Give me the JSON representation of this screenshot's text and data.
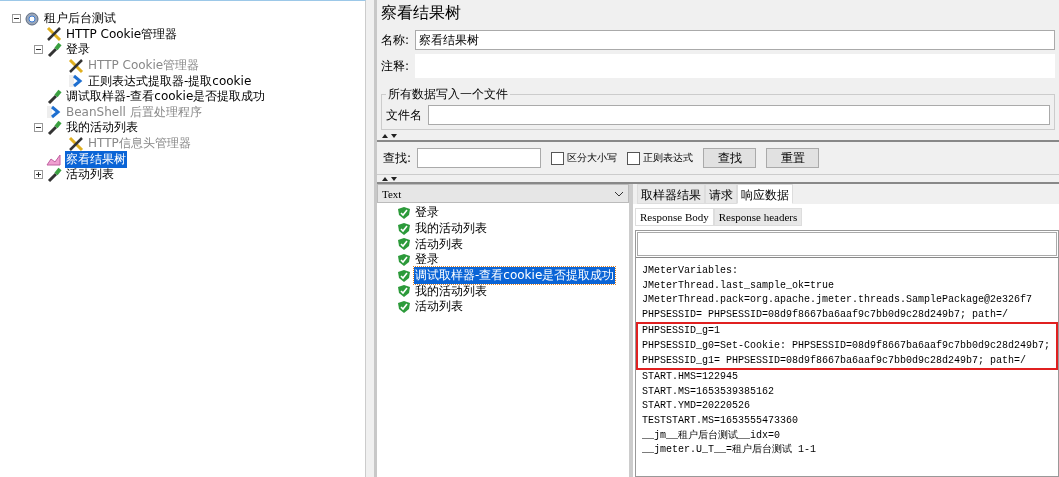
{
  "test_tree": [
    {
      "label": "租户后台测试",
      "kind": "plan",
      "expanded": true,
      "selected": false,
      "disabled": false,
      "children": [
        {
          "label": "HTTP Cookie管理器",
          "kind": "config",
          "selected": false,
          "disabled": false
        },
        {
          "label": "登录",
          "kind": "sampler",
          "expanded": true,
          "selected": false,
          "disabled": false,
          "children": [
            {
              "label": "HTTP Cookie管理器",
              "kind": "config",
              "selected": false,
              "disabled": true
            },
            {
              "label": "正则表达式提取器-提取cookie",
              "kind": "postprocessor",
              "selected": false,
              "disabled": false
            }
          ]
        },
        {
          "label": "调试取样器-查看cookie是否提取成功",
          "kind": "sampler",
          "selected": false,
          "disabled": false
        },
        {
          "label": "BeanShell 后置处理程序",
          "kind": "postprocessor",
          "selected": false,
          "disabled": true
        },
        {
          "label": "我的活动列表",
          "kind": "sampler",
          "expanded": true,
          "selected": false,
          "disabled": false,
          "children": [
            {
              "label": "HTTP信息头管理器",
              "kind": "config",
              "selected": false,
              "disabled": true
            }
          ]
        },
        {
          "label": "察看结果树",
          "kind": "listener",
          "selected": true,
          "disabled": false
        },
        {
          "label": "活动列表",
          "kind": "sampler",
          "expanded": false,
          "selected": false,
          "disabled": false
        }
      ]
    }
  ],
  "panel": {
    "title": "察看结果树",
    "name_label": "名称:",
    "name_value": "察看结果树",
    "comment_label": "注释:",
    "file_group": {
      "legend": "所有数据写入一个文件",
      "filename_label": "文件名"
    },
    "search": {
      "label": "查找:",
      "options": [
        {
          "label": "区分大小写",
          "checked": false
        },
        {
          "label": "正则表达式",
          "checked": false
        }
      ],
      "buttons": [
        "查找",
        "重置"
      ]
    },
    "renderer": "Text",
    "results": [
      {
        "label": "登录",
        "selected": false
      },
      {
        "label": "我的活动列表",
        "selected": false
      },
      {
        "label": "活动列表",
        "selected": false
      },
      {
        "label": "登录",
        "selected": false
      },
      {
        "label": "调试取样器-查看cookie是否提取成功",
        "selected": true
      },
      {
        "label": "我的活动列表",
        "selected": false
      },
      {
        "label": "活动列表",
        "selected": false
      }
    ],
    "tabs": [
      {
        "label": "取样器结果",
        "selected": false
      },
      {
        "label": "请求",
        "selected": false
      },
      {
        "label": "响应数据",
        "selected": true
      }
    ],
    "subtabs": [
      {
        "label": "Response Body",
        "selected": true
      },
      {
        "label": "Response headers",
        "selected": false
      }
    ],
    "response_lines": [
      {
        "text": "JMeterVariables:",
        "boxed": false
      },
      {
        "text": "JMeterThread.last_sample_ok=true",
        "boxed": false
      },
      {
        "text": "JMeterThread.pack=org.apache.jmeter.threads.SamplePackage@2e326f7",
        "boxed": false
      },
      {
        "text": "PHPSESSID= PHPSESSID=08d9f8667ba6aaf9c7bb0d9c28d249b7; path=/",
        "boxed": false
      },
      {
        "text": "PHPSESSID_g=1",
        "boxed": true
      },
      {
        "text": "PHPSESSID_g0=Set-Cookie: PHPSESSID=08d9f8667ba6aaf9c7bb0d9c28d249b7;",
        "boxed": true
      },
      {
        "text": "PHPSESSID_g1= PHPSESSID=08d9f8667ba6aaf9c7bb0d9c28d249b7; path=/",
        "boxed": true
      },
      {
        "text": "START.HMS=122945",
        "boxed": false
      },
      {
        "text": "START.MS=1653539385162",
        "boxed": false
      },
      {
        "text": "START.YMD=20220526",
        "boxed": false
      },
      {
        "text": "TESTSTART.MS=1653555473360",
        "boxed": false
      },
      {
        "text": "__jm__租户后台测试__idx=0",
        "boxed": false
      },
      {
        "text": "__jmeter.U_T__=租户后台测试 1-1",
        "boxed": false
      }
    ]
  }
}
